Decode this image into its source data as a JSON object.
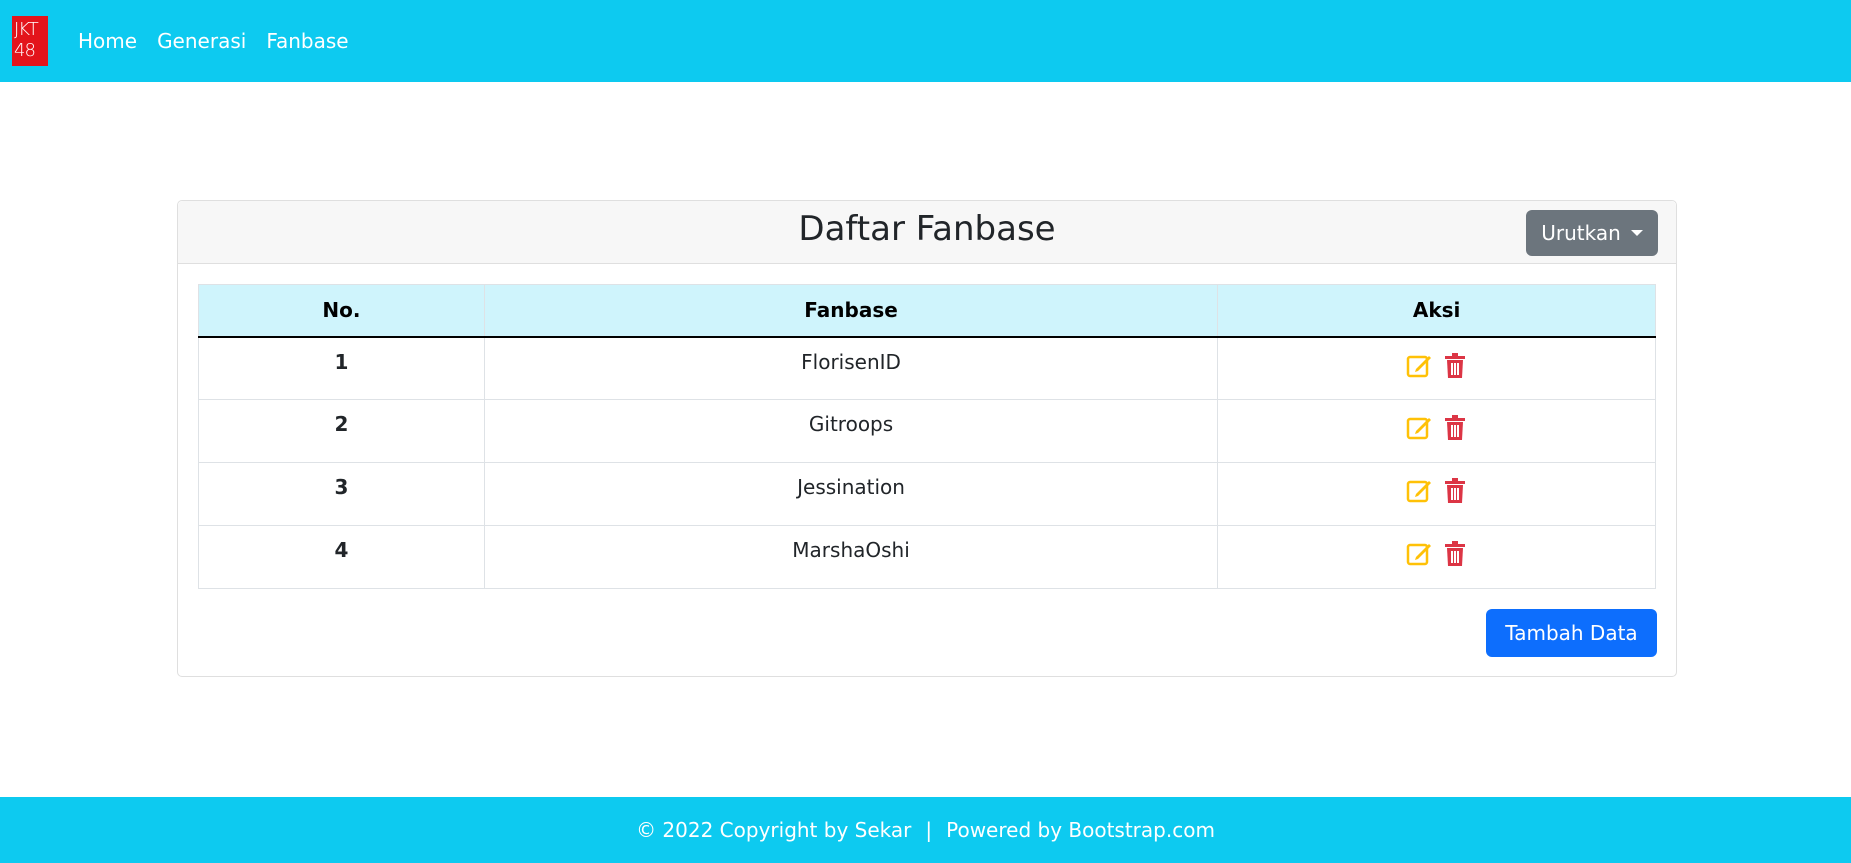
{
  "navbar": {
    "logo_lines": [
      "JKT",
      "48"
    ],
    "links": [
      "Home",
      "Generasi",
      "Fanbase"
    ]
  },
  "card": {
    "title": "Daftar Fanbase",
    "sort_label": "Urutkan",
    "add_label": "Tambah Data"
  },
  "table": {
    "headers": [
      "No.",
      "Fanbase",
      "Aksi"
    ],
    "rows": [
      {
        "no": "1",
        "name": "FlorisenID"
      },
      {
        "no": "2",
        "name": "Gitroops"
      },
      {
        "no": "3",
        "name": "Jessination"
      },
      {
        "no": "4",
        "name": "MarshaOshi"
      }
    ],
    "actions": [
      "edit-icon",
      "trash-icon"
    ]
  },
  "footer": {
    "copyright": "© 2022 Copyright by Sekar",
    "separator": "|",
    "powered": "Powered by Bootstrap.com"
  },
  "colors": {
    "navbar": "#0dcaf0",
    "logo": "#e3141b",
    "edit": "#ffc107",
    "delete": "#dc3545",
    "sort_button": "#6c757d",
    "add_button": "#0d6efd",
    "table_header": "#cff4fc"
  }
}
